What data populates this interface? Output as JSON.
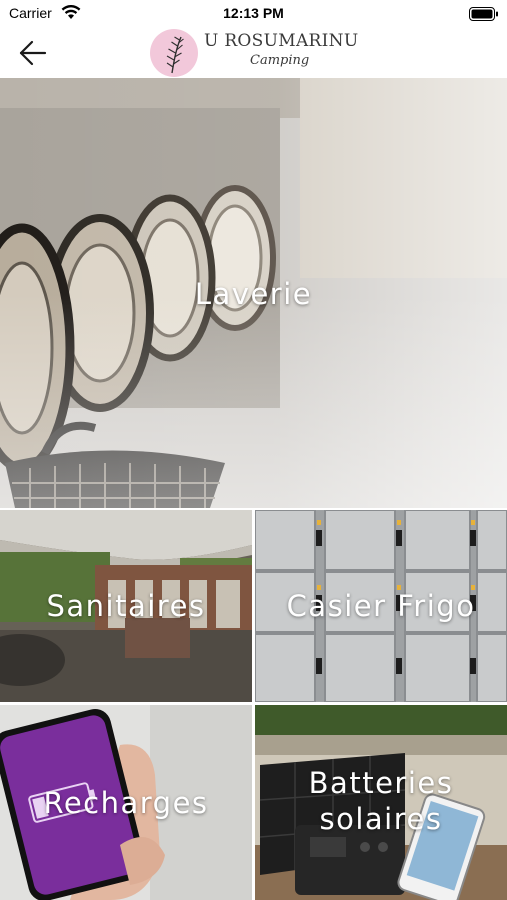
{
  "status_bar": {
    "carrier": "Carrier",
    "time": "12:13 PM",
    "wifi_icon": "wifi-icon",
    "battery_icon": "battery-icon"
  },
  "nav": {
    "back_icon": "arrow-left-icon",
    "brand_name": "U ROSUMARINU",
    "brand_subtitle": "Camping",
    "brand_emblem_color": "#f2c8da"
  },
  "tiles": [
    {
      "label": "Laverie"
    },
    {
      "label": "Sanitaires"
    },
    {
      "label": "Casier Frigo"
    },
    {
      "label": "Recharges"
    },
    {
      "label": "Batteries solaires"
    }
  ],
  "colors": {
    "label_text": "#ffffff",
    "recharges_phone": "#7a2e9c"
  }
}
